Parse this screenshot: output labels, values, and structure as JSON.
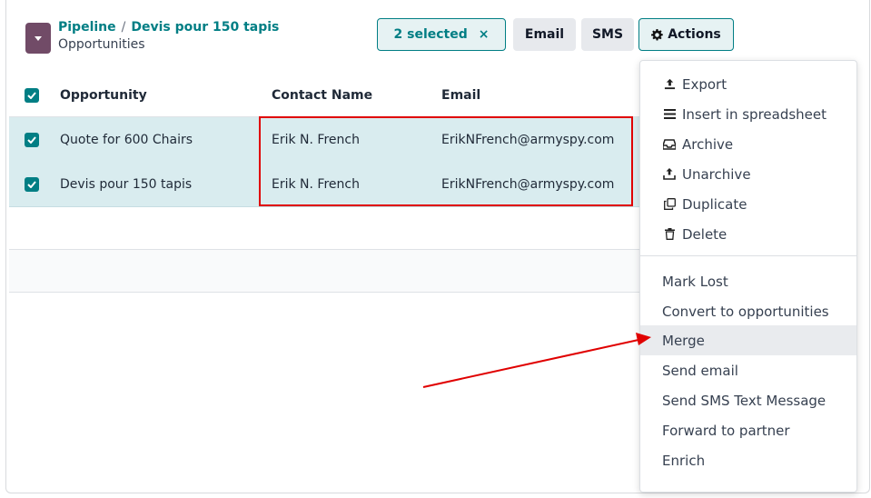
{
  "breadcrumb": {
    "pipeline": "Pipeline",
    "separator": "/",
    "current": "Devis pour 150 tapis",
    "subtitle": "Opportunities"
  },
  "toolbar": {
    "selected_label": "2 selected",
    "clear_icon": "×",
    "email_label": "Email",
    "sms_label": "SMS",
    "actions_label": "Actions"
  },
  "table": {
    "columns": [
      "Opportunity",
      "Contact Name",
      "Email"
    ],
    "rows": [
      {
        "opportunity": "Quote for 600 Chairs",
        "contact": "Erik N. French",
        "email": "ErikNFrench@armyspy.com"
      },
      {
        "opportunity": "Devis pour 150 tapis",
        "contact": "Erik N. French",
        "email": "ErikNFrench@armyspy.com"
      }
    ]
  },
  "menu": {
    "items": [
      {
        "label": "Export",
        "icon": "upload-icon"
      },
      {
        "label": "Insert in spreadsheet",
        "icon": "list-icon"
      },
      {
        "label": "Archive",
        "icon": "inbox-icon"
      },
      {
        "label": "Unarchive",
        "icon": "unarchive-icon"
      },
      {
        "label": "Duplicate",
        "icon": "copy-icon"
      },
      {
        "label": "Delete",
        "icon": "trash-icon"
      }
    ],
    "items2": [
      "Mark Lost",
      "Convert to opportunities",
      "Merge",
      "Send email",
      "Send SMS Text Message",
      "Forward to partner",
      "Enrich"
    ]
  },
  "colors": {
    "brand": "#714b67",
    "accent": "#017e84",
    "row_selected": "#d9ecef",
    "annotation": "#e00000"
  }
}
